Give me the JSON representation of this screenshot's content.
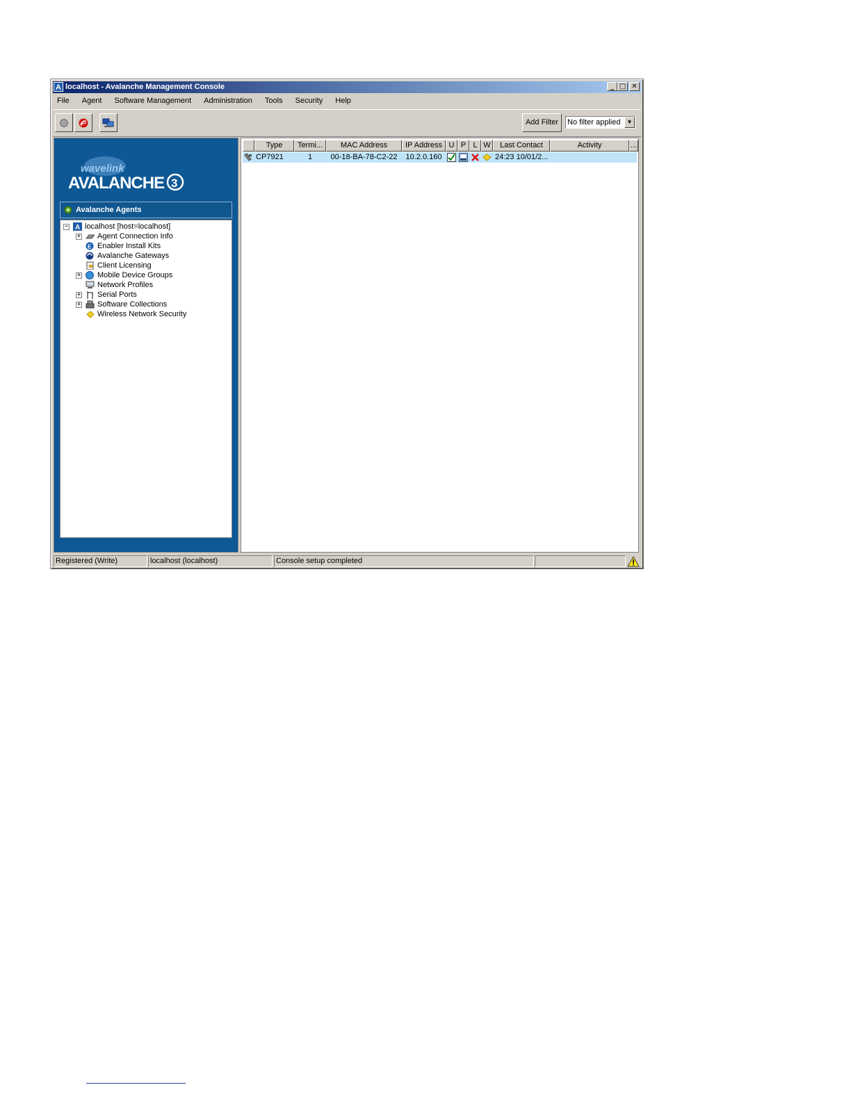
{
  "window": {
    "title": "localhost - Avalanche Management Console",
    "app_icon_letter": "A",
    "controls": {
      "minimize": "_",
      "maximize": "□",
      "close": "✕"
    }
  },
  "menu": [
    {
      "label": "File"
    },
    {
      "label": "Agent"
    },
    {
      "label": "Software Management"
    },
    {
      "label": "Administration"
    },
    {
      "label": "Tools"
    },
    {
      "label": "Security"
    },
    {
      "label": "Help"
    }
  ],
  "toolbar": {
    "add_filter_label": "Add Filter",
    "filter_value": "No filter applied",
    "icons": [
      "connect-icon",
      "disconnect-icon",
      "console-icon"
    ]
  },
  "left_panel": {
    "logo_small": "wavelink",
    "logo_main": "AVALANCHE",
    "logo_version": "3",
    "header": "Avalanche Agents",
    "tree": {
      "root": "localhost [host=localhost]",
      "items": [
        {
          "label": "Agent Connection Info",
          "expandable": true,
          "icon": "connection-icon"
        },
        {
          "label": "Enabler Install Kits",
          "expandable": false,
          "icon": "install-kit-icon"
        },
        {
          "label": "Avalanche Gateways",
          "expandable": false,
          "icon": "gateway-icon"
        },
        {
          "label": "Client Licensing",
          "expandable": false,
          "icon": "license-icon"
        },
        {
          "label": "Mobile Device Groups",
          "expandable": true,
          "icon": "device-group-icon"
        },
        {
          "label": "Network Profiles",
          "expandable": false,
          "icon": "network-icon"
        },
        {
          "label": "Serial Ports",
          "expandable": true,
          "icon": "serial-port-icon"
        },
        {
          "label": "Software Collections",
          "expandable": true,
          "icon": "software-icon"
        },
        {
          "label": "Wireless Network Security",
          "expandable": false,
          "icon": "lock-icon"
        }
      ]
    }
  },
  "grid": {
    "columns": [
      "",
      "Type",
      "Termi...",
      "MAC Address",
      "IP Address",
      "U",
      "P",
      "L",
      "W",
      "Last Contact",
      "Activity",
      "..."
    ],
    "rows": [
      {
        "type": "CP7921",
        "terminal": "1",
        "mac": "00-18-BA-78-C2-22",
        "ip": "10.2.0.160",
        "u": "check-icon",
        "p": "payload-icon",
        "l": "x-icon",
        "w": "lock-icon",
        "last_contact": "24:23 10/01/2..."
      }
    ]
  },
  "status_bar": {
    "registration": "Registered (Write)",
    "host": "localhost (localhost)",
    "message": "Console setup completed",
    "progress": "",
    "warning_icon": "warning-icon"
  },
  "colors": {
    "title_gradient_start": "#0a246a",
    "panel_blue": "#0e5895",
    "selected_row": "#bfe4f8",
    "chrome": "#d4d0c8"
  }
}
